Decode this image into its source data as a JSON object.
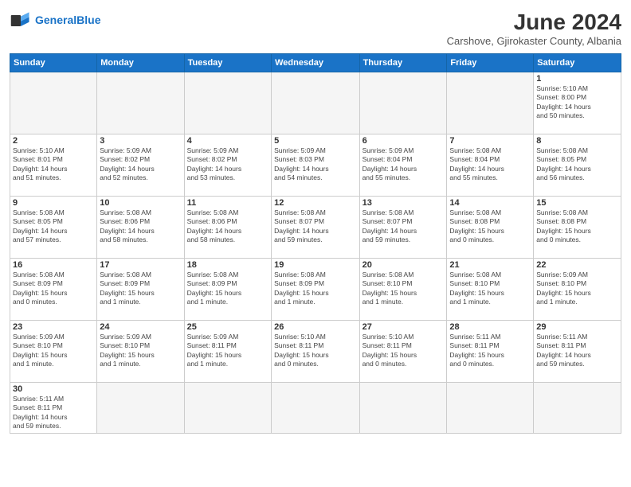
{
  "header": {
    "logo_general": "General",
    "logo_blue": "Blue",
    "month_title": "June 2024",
    "subtitle": "Carshove, Gjirokaster County, Albania"
  },
  "days_of_week": [
    "Sunday",
    "Monday",
    "Tuesday",
    "Wednesday",
    "Thursday",
    "Friday",
    "Saturday"
  ],
  "weeks": [
    [
      {
        "day": "",
        "info": ""
      },
      {
        "day": "",
        "info": ""
      },
      {
        "day": "",
        "info": ""
      },
      {
        "day": "",
        "info": ""
      },
      {
        "day": "",
        "info": ""
      },
      {
        "day": "",
        "info": ""
      },
      {
        "day": "1",
        "info": "Sunrise: 5:10 AM\nSunset: 8:00 PM\nDaylight: 14 hours\nand 50 minutes."
      }
    ],
    [
      {
        "day": "2",
        "info": "Sunrise: 5:10 AM\nSunset: 8:01 PM\nDaylight: 14 hours\nand 51 minutes."
      },
      {
        "day": "3",
        "info": "Sunrise: 5:09 AM\nSunset: 8:02 PM\nDaylight: 14 hours\nand 52 minutes."
      },
      {
        "day": "4",
        "info": "Sunrise: 5:09 AM\nSunset: 8:02 PM\nDaylight: 14 hours\nand 53 minutes."
      },
      {
        "day": "5",
        "info": "Sunrise: 5:09 AM\nSunset: 8:03 PM\nDaylight: 14 hours\nand 54 minutes."
      },
      {
        "day": "6",
        "info": "Sunrise: 5:09 AM\nSunset: 8:04 PM\nDaylight: 14 hours\nand 55 minutes."
      },
      {
        "day": "7",
        "info": "Sunrise: 5:08 AM\nSunset: 8:04 PM\nDaylight: 14 hours\nand 55 minutes."
      },
      {
        "day": "8",
        "info": "Sunrise: 5:08 AM\nSunset: 8:05 PM\nDaylight: 14 hours\nand 56 minutes."
      }
    ],
    [
      {
        "day": "9",
        "info": "Sunrise: 5:08 AM\nSunset: 8:05 PM\nDaylight: 14 hours\nand 57 minutes."
      },
      {
        "day": "10",
        "info": "Sunrise: 5:08 AM\nSunset: 8:06 PM\nDaylight: 14 hours\nand 58 minutes."
      },
      {
        "day": "11",
        "info": "Sunrise: 5:08 AM\nSunset: 8:06 PM\nDaylight: 14 hours\nand 58 minutes."
      },
      {
        "day": "12",
        "info": "Sunrise: 5:08 AM\nSunset: 8:07 PM\nDaylight: 14 hours\nand 59 minutes."
      },
      {
        "day": "13",
        "info": "Sunrise: 5:08 AM\nSunset: 8:07 PM\nDaylight: 14 hours\nand 59 minutes."
      },
      {
        "day": "14",
        "info": "Sunrise: 5:08 AM\nSunset: 8:08 PM\nDaylight: 15 hours\nand 0 minutes."
      },
      {
        "day": "15",
        "info": "Sunrise: 5:08 AM\nSunset: 8:08 PM\nDaylight: 15 hours\nand 0 minutes."
      }
    ],
    [
      {
        "day": "16",
        "info": "Sunrise: 5:08 AM\nSunset: 8:09 PM\nDaylight: 15 hours\nand 0 minutes."
      },
      {
        "day": "17",
        "info": "Sunrise: 5:08 AM\nSunset: 8:09 PM\nDaylight: 15 hours\nand 1 minute."
      },
      {
        "day": "18",
        "info": "Sunrise: 5:08 AM\nSunset: 8:09 PM\nDaylight: 15 hours\nand 1 minute."
      },
      {
        "day": "19",
        "info": "Sunrise: 5:08 AM\nSunset: 8:09 PM\nDaylight: 15 hours\nand 1 minute."
      },
      {
        "day": "20",
        "info": "Sunrise: 5:08 AM\nSunset: 8:10 PM\nDaylight: 15 hours\nand 1 minute."
      },
      {
        "day": "21",
        "info": "Sunrise: 5:08 AM\nSunset: 8:10 PM\nDaylight: 15 hours\nand 1 minute."
      },
      {
        "day": "22",
        "info": "Sunrise: 5:09 AM\nSunset: 8:10 PM\nDaylight: 15 hours\nand 1 minute."
      }
    ],
    [
      {
        "day": "23",
        "info": "Sunrise: 5:09 AM\nSunset: 8:10 PM\nDaylight: 15 hours\nand 1 minute."
      },
      {
        "day": "24",
        "info": "Sunrise: 5:09 AM\nSunset: 8:10 PM\nDaylight: 15 hours\nand 1 minute."
      },
      {
        "day": "25",
        "info": "Sunrise: 5:09 AM\nSunset: 8:11 PM\nDaylight: 15 hours\nand 1 minute."
      },
      {
        "day": "26",
        "info": "Sunrise: 5:10 AM\nSunset: 8:11 PM\nDaylight: 15 hours\nand 0 minutes."
      },
      {
        "day": "27",
        "info": "Sunrise: 5:10 AM\nSunset: 8:11 PM\nDaylight: 15 hours\nand 0 minutes."
      },
      {
        "day": "28",
        "info": "Sunrise: 5:11 AM\nSunset: 8:11 PM\nDaylight: 15 hours\nand 0 minutes."
      },
      {
        "day": "29",
        "info": "Sunrise: 5:11 AM\nSunset: 8:11 PM\nDaylight: 14 hours\nand 59 minutes."
      }
    ],
    [
      {
        "day": "30",
        "info": "Sunrise: 5:11 AM\nSunset: 8:11 PM\nDaylight: 14 hours\nand 59 minutes."
      },
      {
        "day": "",
        "info": ""
      },
      {
        "day": "",
        "info": ""
      },
      {
        "day": "",
        "info": ""
      },
      {
        "day": "",
        "info": ""
      },
      {
        "day": "",
        "info": ""
      },
      {
        "day": "",
        "info": ""
      }
    ]
  ]
}
